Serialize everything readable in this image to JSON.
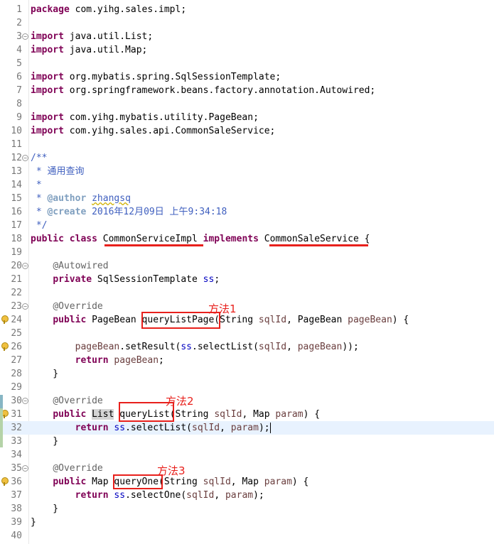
{
  "editor": {
    "lines": [
      {
        "num": "1",
        "parts": [
          {
            "c": "kw",
            "t": "package"
          },
          {
            "c": "txt",
            "t": " com.yihg.sales.impl;"
          }
        ]
      },
      {
        "num": "2",
        "parts": []
      },
      {
        "num": "3",
        "fold": "collapse",
        "parts": [
          {
            "c": "kw",
            "t": "import"
          },
          {
            "c": "txt",
            "t": " java.util.List;"
          }
        ]
      },
      {
        "num": "4",
        "parts": [
          {
            "c": "kw",
            "t": "import"
          },
          {
            "c": "txt",
            "t": " java.util.Map;"
          }
        ]
      },
      {
        "num": "5",
        "parts": []
      },
      {
        "num": "6",
        "parts": [
          {
            "c": "kw",
            "t": "import"
          },
          {
            "c": "txt",
            "t": " org.mybatis.spring.SqlSessionTemplate;"
          }
        ]
      },
      {
        "num": "7",
        "parts": [
          {
            "c": "kw",
            "t": "import"
          },
          {
            "c": "txt",
            "t": " org.springframework.beans.factory.annotation.Autowired;"
          }
        ]
      },
      {
        "num": "8",
        "parts": []
      },
      {
        "num": "9",
        "parts": [
          {
            "c": "kw",
            "t": "import"
          },
          {
            "c": "txt",
            "t": " com.yihg.mybatis.utility.PageBean;"
          }
        ]
      },
      {
        "num": "10",
        "parts": [
          {
            "c": "kw",
            "t": "import"
          },
          {
            "c": "txt",
            "t": " com.yihg.sales.api.CommonSaleService;"
          }
        ]
      },
      {
        "num": "11",
        "parts": []
      },
      {
        "num": "12",
        "fold": "collapse",
        "parts": [
          {
            "c": "cm",
            "t": "/**"
          }
        ]
      },
      {
        "num": "13",
        "parts": [
          {
            "c": "cm",
            "t": " * 通用查询"
          }
        ]
      },
      {
        "num": "14",
        "parts": [
          {
            "c": "cm",
            "t": " *"
          }
        ]
      },
      {
        "num": "15",
        "parts": [
          {
            "c": "cm",
            "t": " * "
          },
          {
            "c": "tag",
            "t": "@author"
          },
          {
            "c": "cm",
            "t": " "
          },
          {
            "c": "cm squig",
            "t": "zhangsq"
          }
        ]
      },
      {
        "num": "16",
        "parts": [
          {
            "c": "cm",
            "t": " * "
          },
          {
            "c": "tag",
            "t": "@create"
          },
          {
            "c": "cm",
            "t": " 2016年12月09日 上午9:34:18"
          }
        ]
      },
      {
        "num": "17",
        "parts": [
          {
            "c": "cm",
            "t": " */"
          }
        ]
      },
      {
        "num": "18",
        "parts": [
          {
            "c": "kw",
            "t": "public"
          },
          {
            "c": "txt",
            "t": " "
          },
          {
            "c": "kw",
            "t": "class"
          },
          {
            "c": "txt",
            "t": " CommonServiceImpl "
          },
          {
            "c": "kw",
            "t": "implements"
          },
          {
            "c": "txt",
            "t": " CommonSaleService {"
          }
        ]
      },
      {
        "num": "19",
        "parts": []
      },
      {
        "num": "20",
        "fold": "collapse",
        "parts": [
          {
            "c": "txt",
            "t": "    "
          },
          {
            "c": "ann",
            "t": "@Autowired"
          }
        ]
      },
      {
        "num": "21",
        "parts": [
          {
            "c": "txt",
            "t": "    "
          },
          {
            "c": "kw",
            "t": "private"
          },
          {
            "c": "txt",
            "t": " SqlSessionTemplate "
          },
          {
            "c": "fld",
            "t": "ss"
          },
          {
            "c": "txt",
            "t": ";"
          }
        ]
      },
      {
        "num": "22",
        "parts": []
      },
      {
        "num": "23",
        "fold": "collapse",
        "parts": [
          {
            "c": "txt",
            "t": "    "
          },
          {
            "c": "ann",
            "t": "@Override"
          }
        ]
      },
      {
        "num": "24",
        "marker": true,
        "parts": [
          {
            "c": "txt",
            "t": "    "
          },
          {
            "c": "kw",
            "t": "public"
          },
          {
            "c": "txt",
            "t": " PageBean queryListPage(String "
          },
          {
            "c": "par",
            "t": "sqlId"
          },
          {
            "c": "txt",
            "t": ", PageBean "
          },
          {
            "c": "par",
            "t": "pageBean"
          },
          {
            "c": "txt",
            "t": ") {"
          }
        ]
      },
      {
        "num": "25",
        "parts": []
      },
      {
        "num": "26",
        "marker": true,
        "parts": [
          {
            "c": "txt",
            "t": "        "
          },
          {
            "c": "par",
            "t": "pageBean"
          },
          {
            "c": "txt",
            "t": ".setResult("
          },
          {
            "c": "fld",
            "t": "ss"
          },
          {
            "c": "txt",
            "t": ".selectList("
          },
          {
            "c": "par",
            "t": "sqlId"
          },
          {
            "c": "txt",
            "t": ", "
          },
          {
            "c": "par",
            "t": "pageBean"
          },
          {
            "c": "txt",
            "t": "));"
          }
        ]
      },
      {
        "num": "27",
        "parts": [
          {
            "c": "txt",
            "t": "        "
          },
          {
            "c": "kw",
            "t": "return"
          },
          {
            "c": "txt",
            "t": " "
          },
          {
            "c": "par",
            "t": "pageBean"
          },
          {
            "c": "txt",
            "t": ";"
          }
        ]
      },
      {
        "num": "28",
        "parts": [
          {
            "c": "txt",
            "t": "    }"
          }
        ]
      },
      {
        "num": "29",
        "parts": []
      },
      {
        "num": "30",
        "fold": "collapse",
        "parts": [
          {
            "c": "txt",
            "t": "    "
          },
          {
            "c": "ann",
            "t": "@Override"
          }
        ]
      },
      {
        "num": "31",
        "marker": true,
        "parts": [
          {
            "c": "txt",
            "t": "    "
          },
          {
            "c": "kw",
            "t": "public"
          },
          {
            "c": "txt",
            "t": " "
          },
          {
            "c": "txt ctx",
            "t": "List"
          },
          {
            "c": "txt",
            "t": " queryList(String "
          },
          {
            "c": "par",
            "t": "sqlId"
          },
          {
            "c": "txt",
            "t": ", Map "
          },
          {
            "c": "par",
            "t": "param"
          },
          {
            "c": "txt",
            "t": ") {"
          }
        ]
      },
      {
        "num": "32",
        "current": true,
        "parts": [
          {
            "c": "txt",
            "t": "        "
          },
          {
            "c": "kw",
            "t": "return"
          },
          {
            "c": "txt",
            "t": " "
          },
          {
            "c": "fld",
            "t": "ss"
          },
          {
            "c": "txt",
            "t": ".selectList("
          },
          {
            "c": "par",
            "t": "sqlId"
          },
          {
            "c": "txt",
            "t": ", "
          },
          {
            "c": "par",
            "t": "param"
          },
          {
            "c": "txt",
            "t": ");"
          }
        ]
      },
      {
        "num": "33",
        "parts": [
          {
            "c": "txt",
            "t": "    }"
          }
        ]
      },
      {
        "num": "34",
        "parts": []
      },
      {
        "num": "35",
        "fold": "collapse",
        "parts": [
          {
            "c": "txt",
            "t": "    "
          },
          {
            "c": "ann",
            "t": "@Override"
          }
        ]
      },
      {
        "num": "36",
        "marker": true,
        "parts": [
          {
            "c": "txt",
            "t": "    "
          },
          {
            "c": "kw",
            "t": "public"
          },
          {
            "c": "txt",
            "t": " Map queryOne(String "
          },
          {
            "c": "par",
            "t": "sqlId"
          },
          {
            "c": "txt",
            "t": ", Map "
          },
          {
            "c": "par",
            "t": "param"
          },
          {
            "c": "txt",
            "t": ") {"
          }
        ]
      },
      {
        "num": "37",
        "parts": [
          {
            "c": "txt",
            "t": "        "
          },
          {
            "c": "kw",
            "t": "return"
          },
          {
            "c": "txt",
            "t": " "
          },
          {
            "c": "fld",
            "t": "ss"
          },
          {
            "c": "txt",
            "t": ".selectOne("
          },
          {
            "c": "par",
            "t": "sqlId"
          },
          {
            "c": "txt",
            "t": ", "
          },
          {
            "c": "par",
            "t": "param"
          },
          {
            "c": "txt",
            "t": ");"
          }
        ]
      },
      {
        "num": "38",
        "parts": [
          {
            "c": "txt",
            "t": "    }"
          }
        ]
      },
      {
        "num": "39",
        "parts": [
          {
            "c": "txt",
            "t": "}"
          }
        ]
      },
      {
        "num": "40",
        "parts": []
      }
    ]
  },
  "annotations": {
    "method1_label": "方法1",
    "method2_label": "方法2",
    "method3_label": "方法3"
  },
  "colors": {
    "keyword": "#7f0055",
    "comment": "#3f5fbf",
    "annotation_red": "#e8201c",
    "current_line": "#e8f2fe"
  }
}
